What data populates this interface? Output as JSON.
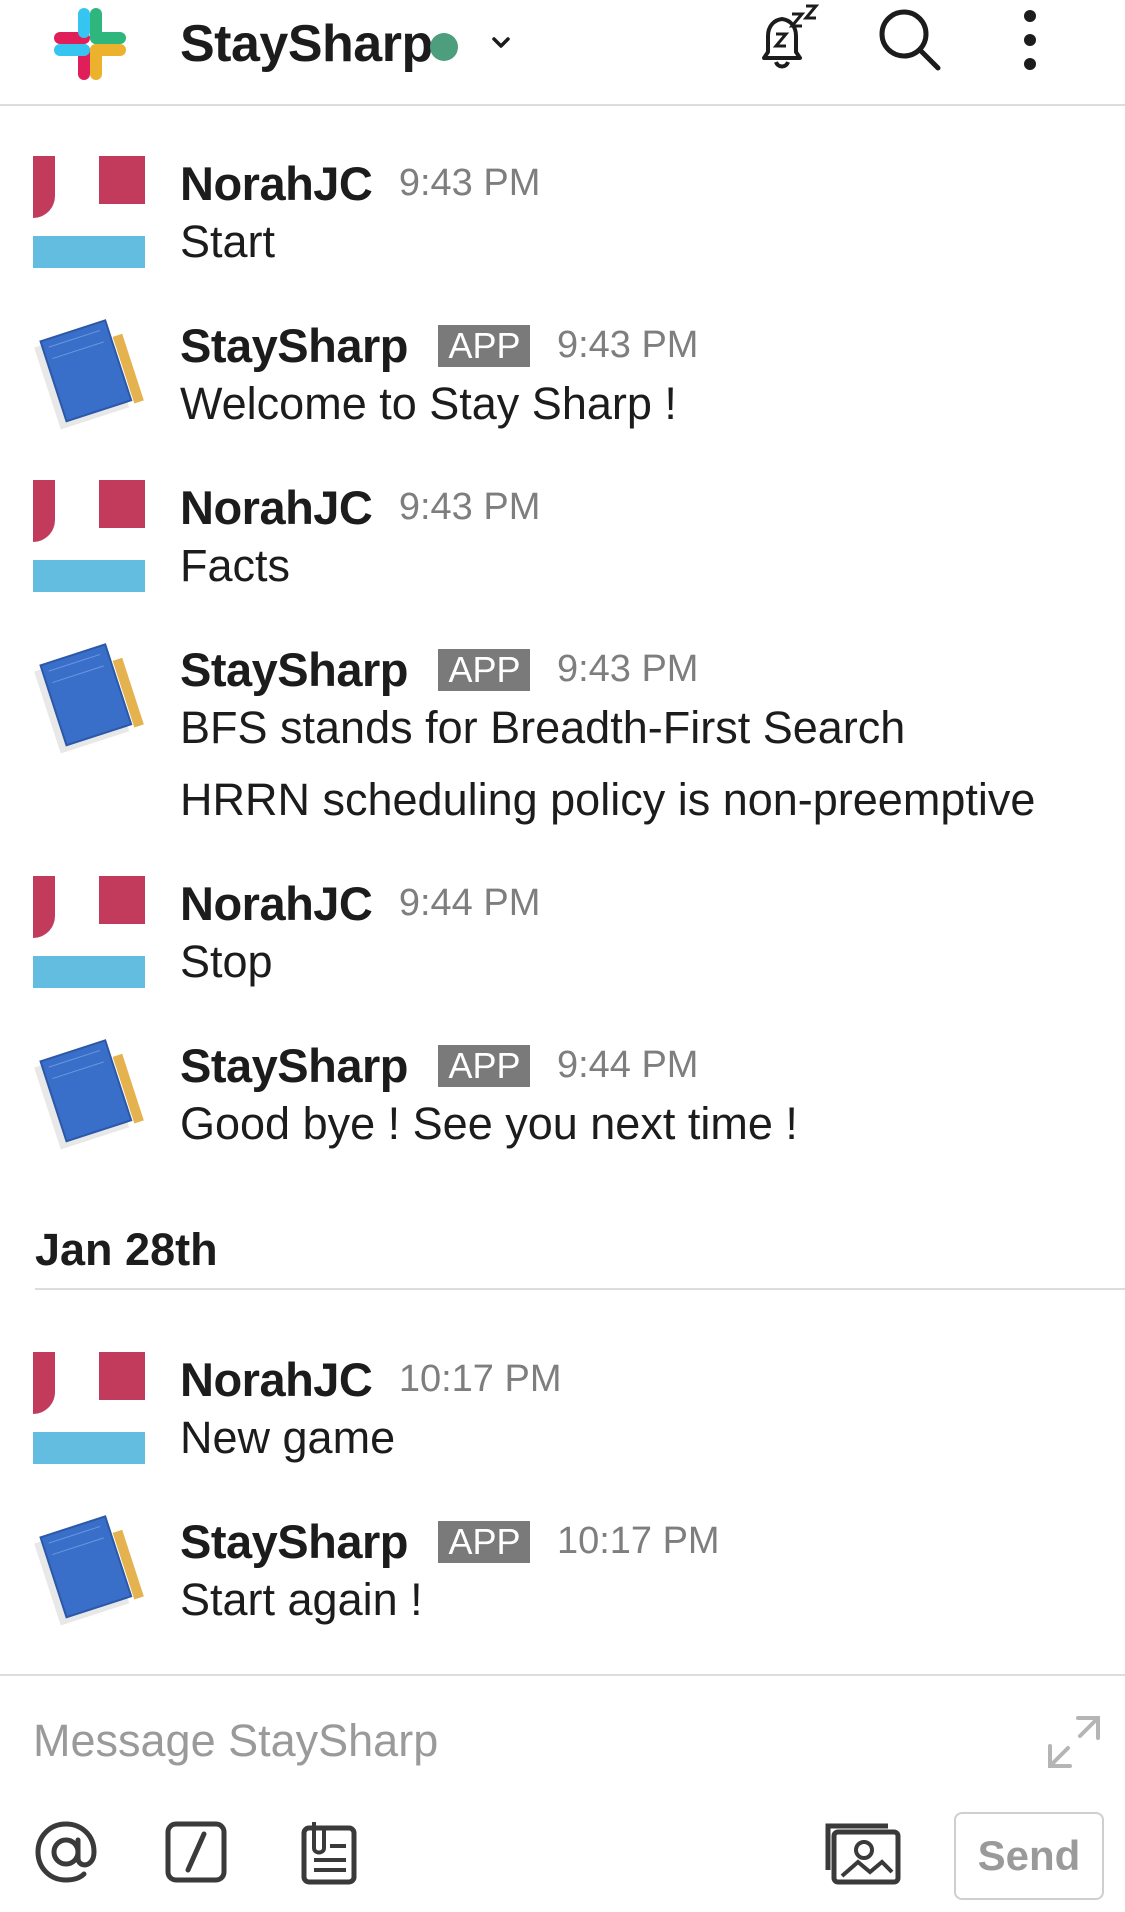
{
  "header": {
    "workspace_title": "StaySharp",
    "presence_color": "#4d9e7c",
    "icons": [
      "slack-logo",
      "snooze-bell-icon",
      "search-icon",
      "more-vertical-icon"
    ]
  },
  "messages": [
    {
      "author": "NorahJC",
      "is_app": false,
      "time": "9:43 PM",
      "lines": [
        "Start"
      ]
    },
    {
      "author": "StaySharp",
      "is_app": true,
      "badge": "APP",
      "time": "9:43 PM",
      "lines": [
        "Welcome to Stay Sharp !"
      ]
    },
    {
      "author": "NorahJC",
      "is_app": false,
      "time": "9:43 PM",
      "lines": [
        "Facts"
      ]
    },
    {
      "author": "StaySharp",
      "is_app": true,
      "badge": "APP",
      "time": "9:43 PM",
      "lines": [
        "BFS stands for Breadth-First Search",
        "HRRN scheduling policy is non-preemptive"
      ]
    },
    {
      "author": "NorahJC",
      "is_app": false,
      "time": "9:44 PM",
      "lines": [
        "Stop"
      ]
    },
    {
      "author": "StaySharp",
      "is_app": true,
      "badge": "APP",
      "time": "9:44 PM",
      "lines": [
        "Good bye ! See you next time !"
      ]
    },
    {
      "author": "NorahJC",
      "is_app": false,
      "time": "10:17 PM",
      "lines": [
        "New game"
      ]
    },
    {
      "author": "StaySharp",
      "is_app": true,
      "badge": "APP",
      "time": "10:17 PM",
      "lines": [
        "Start again !"
      ]
    }
  ],
  "day_separator": "Jan 28th",
  "composer": {
    "placeholder": "Message StaySharp",
    "send_label": "Send",
    "icons": [
      "expand-icon",
      "at-mention-icon",
      "slash-command-icon",
      "clipboard-icon",
      "photo-icon"
    ]
  }
}
